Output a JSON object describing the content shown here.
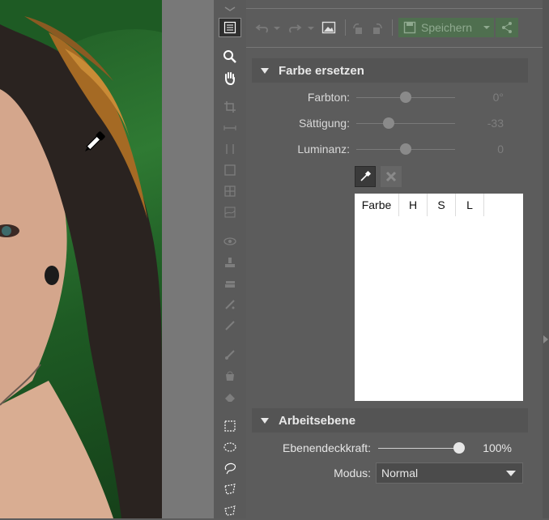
{
  "toolbar": {
    "save_label": "Speichern"
  },
  "replace_color": {
    "title": "Farbe ersetzen",
    "sliders": [
      {
        "label": "Farbton:",
        "value": "0°",
        "level": 0.5
      },
      {
        "label": "Sättigung:",
        "value": "-33",
        "level": 0.33
      },
      {
        "label": "Luminanz:",
        "value": "0",
        "level": 0.5
      }
    ],
    "table_headers": [
      "Farbe",
      "H",
      "S",
      "L"
    ]
  },
  "work_layer": {
    "title": "Arbeitsebene",
    "opacity_label": "Ebenendeckkraft:",
    "opacity_value": "100%",
    "opacity_level": 1.0,
    "mode_label": "Modus:",
    "mode_value": "Normal"
  },
  "icons": {
    "tools": [
      "layers-icon",
      "adjust-panel-icon",
      "zoom-icon",
      "hand-icon",
      "crop-icon",
      "straighten-icon",
      "perspective-vertical-icon",
      "resize-icon",
      "warp-icon",
      "gradient-icon",
      "red-eye-icon",
      "stamp-icon",
      "smooth-icon",
      "brush-fix-icon",
      "brush-heal-icon",
      "paint-brush-icon",
      "bucket-icon",
      "eraser-icon",
      "rect-select-icon",
      "ellipse-select-icon",
      "lasso-icon",
      "polygon-lasso-icon",
      "magic-lasso-icon"
    ]
  }
}
